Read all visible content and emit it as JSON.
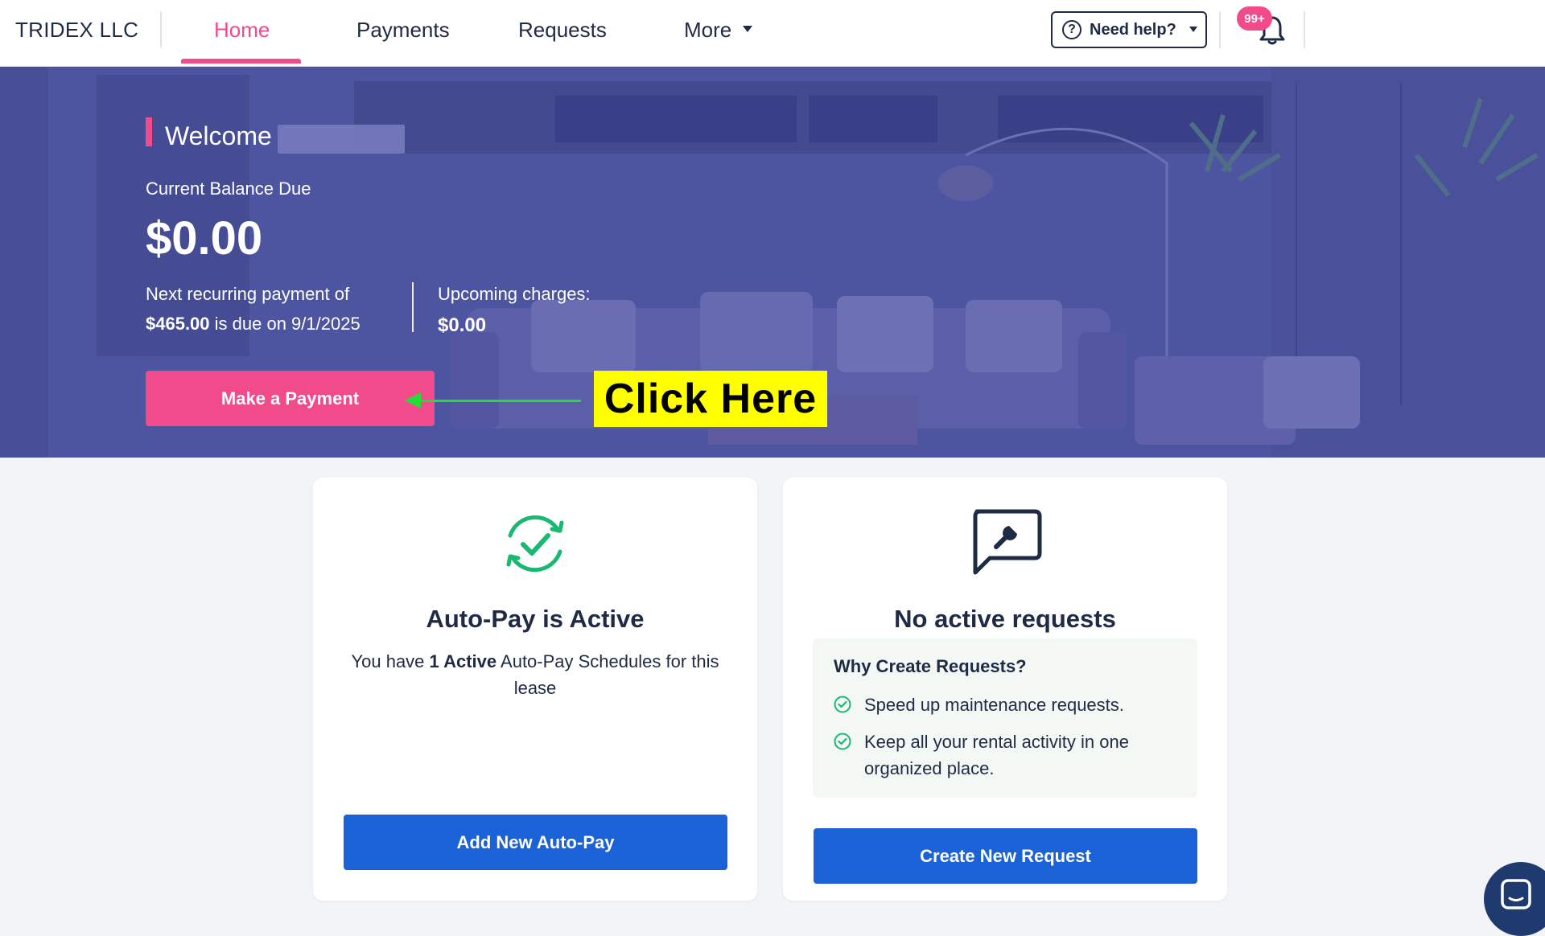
{
  "header": {
    "brand": "TRIDEX LLC",
    "nav": [
      {
        "label": "Home",
        "active": true
      },
      {
        "label": "Payments",
        "active": false
      },
      {
        "label": "Requests",
        "active": false
      },
      {
        "label": "More",
        "active": false
      }
    ],
    "help_label": "Need help?",
    "notification_count": "99+"
  },
  "hero": {
    "welcome": "Welcome",
    "balance_label": "Current Balance Due",
    "balance": "$0.00",
    "recurring_prefix": "Next recurring payment of",
    "recurring_amount": "$465.00",
    "recurring_suffix": "is due on 9/1/2025",
    "upcoming_label": "Upcoming charges:",
    "upcoming_amount": "$0.00",
    "pay_button": "Make a Payment",
    "annotation": "Click Here"
  },
  "autopay_card": {
    "title": "Auto-Pay is Active",
    "body_prefix": "You have",
    "body_bold": "1 Active",
    "body_suffix": "Auto-Pay Schedules for this lease",
    "button": "Add New Auto-Pay"
  },
  "requests_card": {
    "title": "No active requests",
    "why_title": "Why Create Requests?",
    "why_items": [
      "Speed up maintenance requests.",
      "Keep all your rental activity in one organized place."
    ],
    "button": "Create New Request"
  },
  "colors": {
    "accent_pink": "#f14b8c",
    "primary_blue": "#1a62d6",
    "success_green": "#19b873",
    "hero_overlay": "#4f56a0",
    "annotation_yellow": "#ffff00"
  },
  "icons": [
    "question-circle-icon",
    "chevron-down-icon",
    "bell-icon",
    "autopay-check-icon",
    "request-wrench-icon",
    "check-circle-icon",
    "chat-icon"
  ]
}
